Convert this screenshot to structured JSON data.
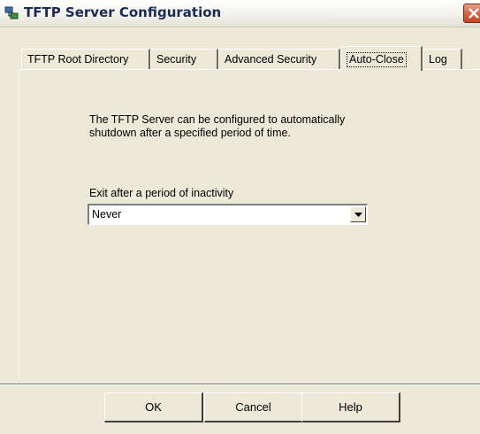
{
  "window": {
    "title": "TFTP Server Configuration"
  },
  "icons": {
    "app": "network-server-icon",
    "close": "close-icon",
    "dropdown": "chevron-down-icon"
  },
  "tabs": [
    {
      "label": "TFTP Root Directory"
    },
    {
      "label": "Security"
    },
    {
      "label": "Advanced Security"
    },
    {
      "label": "Auto-Close",
      "active": true
    },
    {
      "label": "Log"
    }
  ],
  "autoclose": {
    "description": "The TFTP Server can be configured to automatically shutdown after a specified period of time.",
    "exit_label": "Exit after a period of inactivity",
    "exit_value": "Never"
  },
  "buttons": {
    "ok": "OK",
    "cancel": "Cancel",
    "help": "Help"
  },
  "colors": {
    "dialog_bg": "#ece9d8",
    "title_text": "#1b2b57",
    "close_red": "#d96a4c"
  }
}
